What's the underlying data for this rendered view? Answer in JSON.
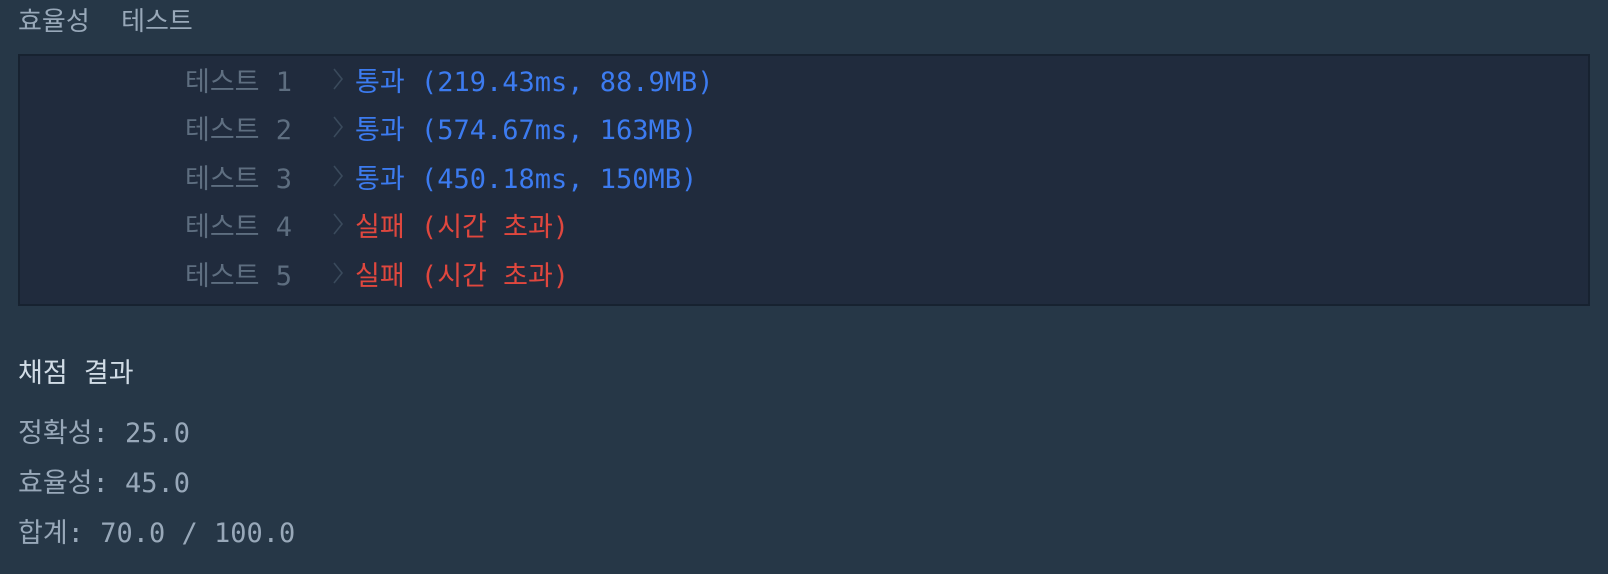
{
  "section_header": "효율성  테스트",
  "tests": [
    {
      "label": "테스트 1",
      "result": "통과 (219.43ms, 88.9MB)",
      "status": "pass"
    },
    {
      "label": "테스트 2",
      "result": "통과 (574.67ms, 163MB)",
      "status": "pass"
    },
    {
      "label": "테스트 3",
      "result": "통과 (450.18ms, 150MB)",
      "status": "pass"
    },
    {
      "label": "테스트 4",
      "result": "실패 (시간 초과)",
      "status": "fail"
    },
    {
      "label": "테스트 5",
      "result": "실패 (시간 초과)",
      "status": "fail"
    }
  ],
  "grading": {
    "title": "채점 결과",
    "accuracy": "정확성: 25.0",
    "efficiency": "효율성: 45.0",
    "total": "합계: 70.0 / 100.0"
  },
  "colors": {
    "background": "#263747",
    "panel": "#202b3d",
    "pass": "#3c7bf0",
    "fail": "#e0473e",
    "muted": "#5e6e80"
  },
  "icons": {
    "row_separator": "chevron-right-icon"
  }
}
